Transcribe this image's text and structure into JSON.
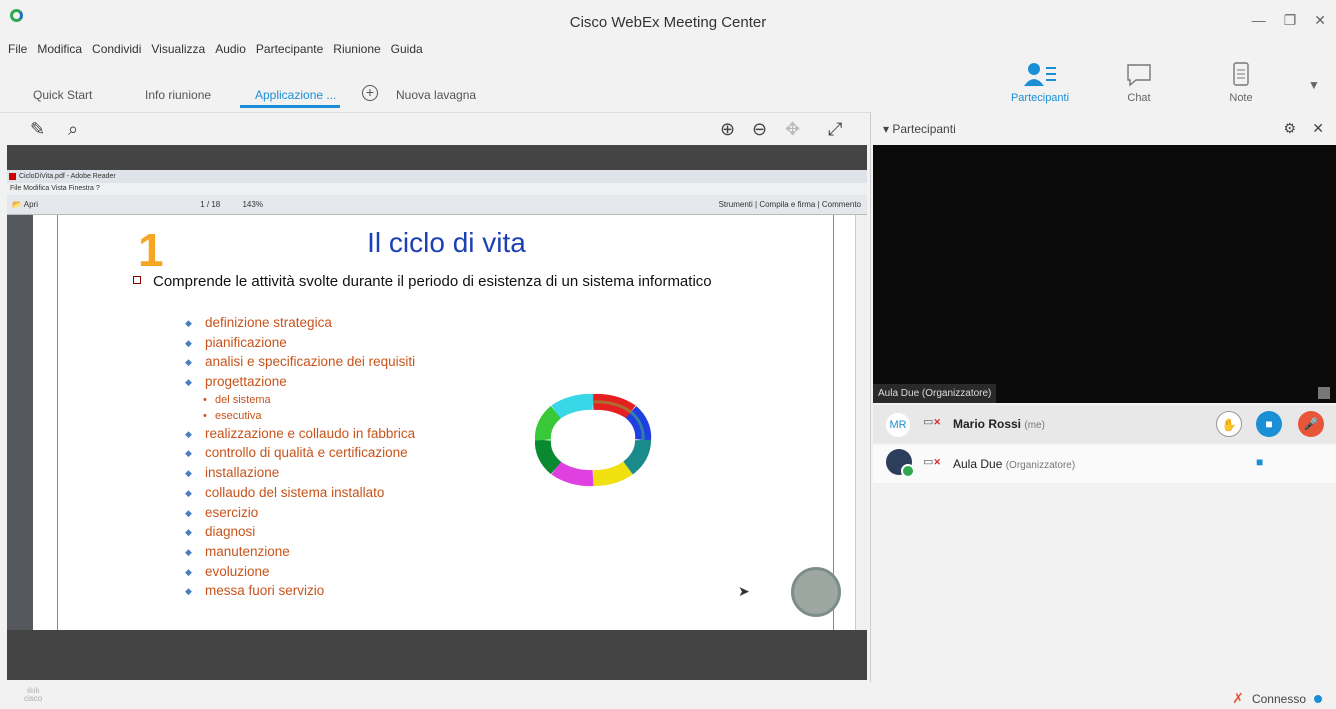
{
  "window": {
    "title": "Cisco WebEx Meeting Center",
    "minimize": "—",
    "restore": "❐",
    "close": "✕"
  },
  "menu": [
    "File",
    "Modifica",
    "Condividi",
    "Visualizza",
    "Audio",
    "Partecipante",
    "Riunione",
    "Guida"
  ],
  "tabs": {
    "quick_start": "Quick Start",
    "info": "Info riunione",
    "app": "Applicazione ...",
    "new_board": "Nuova lavagna"
  },
  "panel_tabs": {
    "participants": "Partecipanti",
    "chat": "Chat",
    "notes": "Note"
  },
  "panel": {
    "header": "Partecipanti",
    "video_label": "Aula Due (Organizzatore)"
  },
  "participants": [
    {
      "initials": "MR",
      "name": "Mario Rossi",
      "tag": "(me)"
    },
    {
      "name": "Aula Due",
      "tag": "(Organizzatore)"
    }
  ],
  "reader": {
    "title": "CicloDiVita.pdf - Adobe Reader",
    "menu": "File  Modifica  Vista  Finestra  ?",
    "open_label": "Apri",
    "page": "1",
    "pages": "/ 18",
    "zoom": "143%",
    "tools": "Strumenti",
    "sign": "Compila e firma",
    "comment": "Commento"
  },
  "slide": {
    "number": "1",
    "title": "Il ciclo di vita",
    "main": "Comprende le attività svolte durante il periodo di esistenza di un sistema informatico",
    "items": [
      "definizione strategica",
      "pianificazione",
      "analisi e specificazione dei requisiti",
      "progettazione"
    ],
    "subitems": [
      "del sistema",
      "esecutiva"
    ],
    "items2": [
      "realizzazione e collaudo in fabbrica",
      "controllo di qualità e certificazione",
      "installazione",
      "collaudo del sistema installato",
      "esercizio",
      "diagnosi",
      "manutenzione",
      "evoluzione",
      "messa fuori servizio"
    ]
  },
  "status": {
    "connection": "Connesso"
  },
  "brand": {
    "cisco": "cisco"
  },
  "colors": {
    "accent": "#1b8fd6",
    "slide_title": "#1d3fb5",
    "slide_item": "#c8531a",
    "mute": "#e8563a"
  }
}
